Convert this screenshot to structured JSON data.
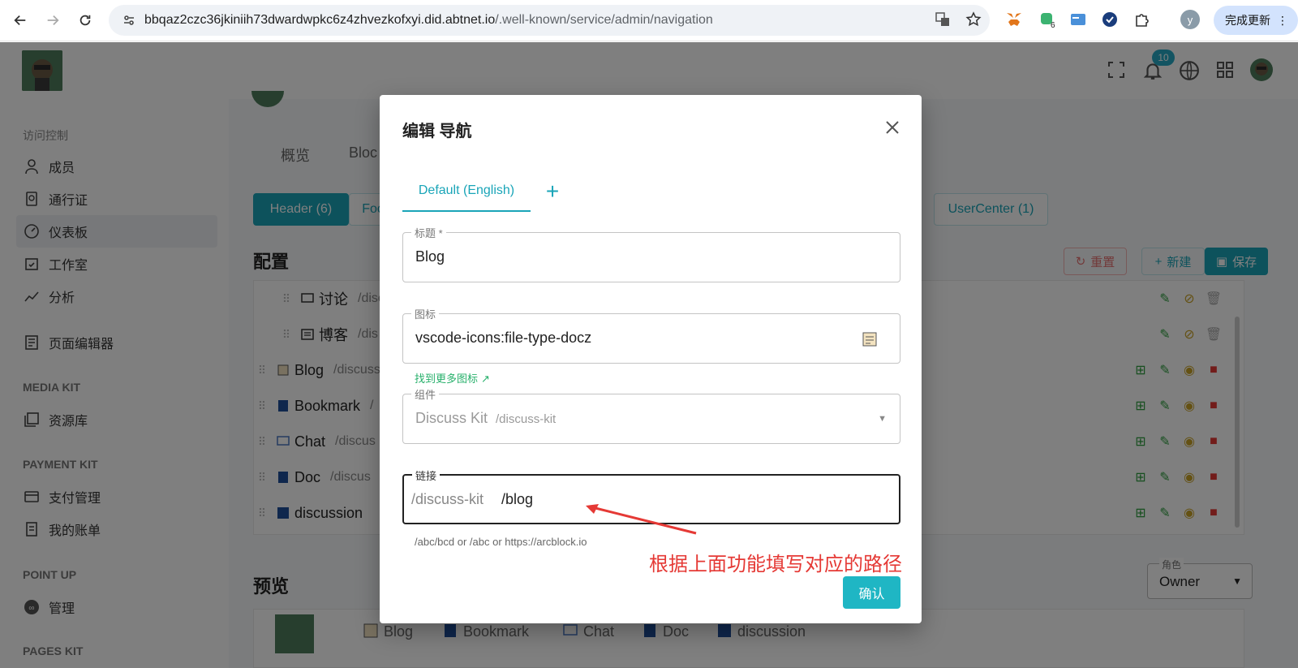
{
  "browser": {
    "url_main": "bbqaz2czc36jkiniih73dwardwpkc6z4zhvezkofxyi.did.abtnet.io",
    "url_path": "/.well-known/service/admin/navigation",
    "update_button": "完成更新",
    "profile_initial": "y",
    "ext_badge": "6"
  },
  "header": {
    "notification_count": "10"
  },
  "sidebar": {
    "section_access": "访问控制",
    "items": [
      {
        "label": "成员",
        "icon": "user-icon"
      },
      {
        "label": "通行证",
        "icon": "passport-icon"
      },
      {
        "label": "仪表板",
        "icon": "dashboard-icon"
      },
      {
        "label": "工作室",
        "icon": "studio-icon"
      },
      {
        "label": "分析",
        "icon": "analytics-icon"
      },
      {
        "label": "页面编辑器",
        "icon": "page-editor-icon"
      },
      {
        "label": "资源库",
        "icon": "library-icon"
      },
      {
        "label": "支付管理",
        "icon": "payment-icon"
      },
      {
        "label": "我的账单",
        "icon": "bill-icon"
      },
      {
        "label": "管理",
        "icon": "manage-icon"
      }
    ],
    "section_media": "MEDIA KIT",
    "section_payment": "PAYMENT KIT",
    "section_point": "POINT UP",
    "section_pages": "PAGES KIT"
  },
  "main": {
    "top_tabs": [
      "概览",
      "Bloc"
    ],
    "chips": [
      "Header (6)",
      "Foo",
      "UserCenter (1)"
    ],
    "config_title": "配置",
    "reset_label": "重置",
    "new_label": "新建",
    "save_label": "保存",
    "rows": [
      {
        "label": "讨论",
        "path": "/disc"
      },
      {
        "label": "博客",
        "path": "/dis"
      },
      {
        "label": "Blog",
        "path": "/discuss"
      },
      {
        "label": "Bookmark",
        "path": "/"
      },
      {
        "label": "Chat",
        "path": "/discus"
      },
      {
        "label": "Doc",
        "path": "/discus"
      },
      {
        "label": "discussion",
        "path": ""
      }
    ],
    "preview_title": "预览",
    "preview_items": [
      "Blog",
      "Bookmark",
      "Chat",
      "Doc",
      "discussion"
    ],
    "role_label": "角色",
    "role_value": "Owner"
  },
  "modal": {
    "title": "编辑 导航",
    "tab_default": "Default (English)",
    "title_label": "标题 *",
    "title_value": "Blog",
    "icon_label": "图标",
    "icon_value": "vscode-icons:file-type-docz",
    "find_icons": "找到更多图标",
    "component_label": "组件",
    "component_value": "Discuss Kit",
    "component_path": "/discuss-kit",
    "link_label": "链接",
    "link_prefix": "/discuss-kit",
    "link_value": "/blog",
    "link_helper": "/abc/bcd or /abc or https://arcblock.io",
    "annotation": "根据上面功能填写对应的路径",
    "confirm": "确认"
  }
}
